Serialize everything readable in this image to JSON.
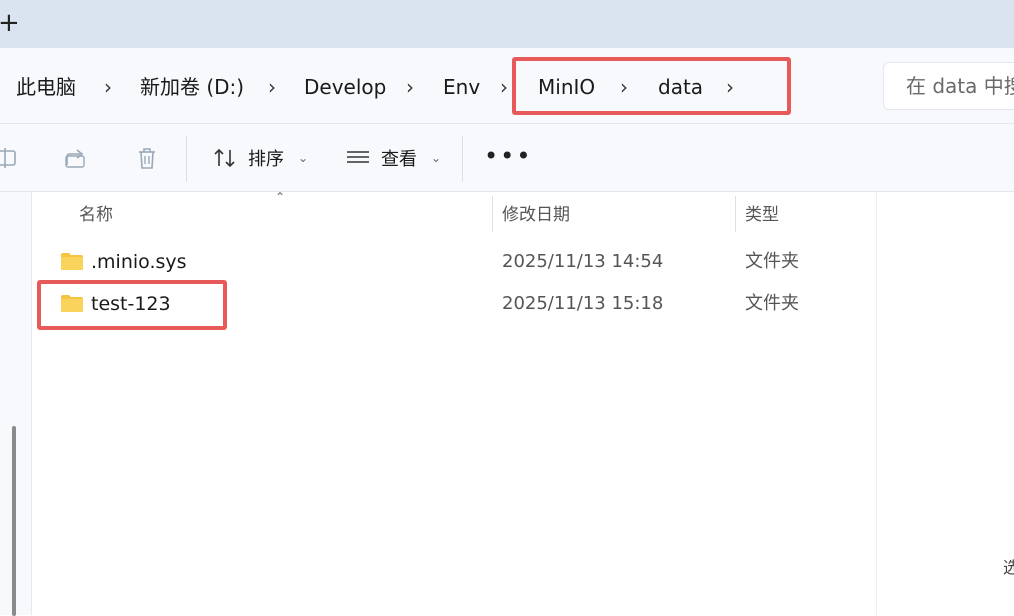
{
  "tabbar": {
    "new_tab_glyph": "+"
  },
  "breadcrumb": {
    "items": [
      "此电脑",
      "新加卷 (D:)",
      "Develop",
      "Env",
      "MinIO",
      "data"
    ],
    "separator": "›"
  },
  "search": {
    "placeholder": "在 data 中搜"
  },
  "toolbar": {
    "sort_label": "排序",
    "view_label": "查看",
    "more_glyph": "•••"
  },
  "columns": {
    "name": "名称",
    "modified": "修改日期",
    "type": "类型"
  },
  "files": [
    {
      "name": ".minio.sys",
      "modified": "2025/11/13 14:54",
      "type": "文件夹"
    },
    {
      "name": "test-123",
      "modified": "2025/11/13 15:18",
      "type": "文件夹"
    }
  ],
  "right_pane": {
    "fragment": "选"
  },
  "colors": {
    "highlight": "#e85a5a",
    "folder": "#f5c542",
    "tabbar": "#d9e4f0"
  }
}
